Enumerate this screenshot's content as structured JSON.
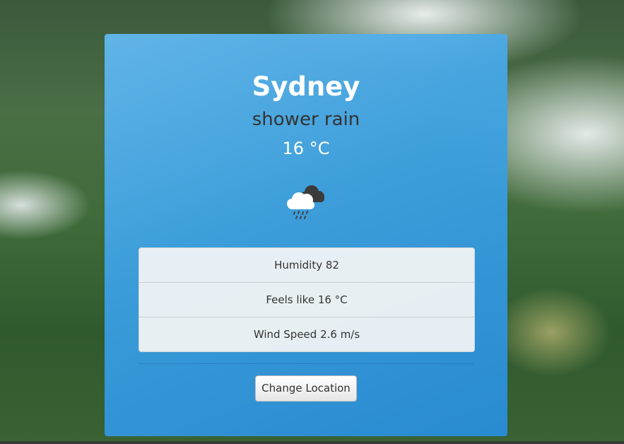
{
  "weather": {
    "city": "Sydney",
    "description": "shower rain",
    "temperature": "16 °C",
    "icon": "shower-rain-cloud-icon"
  },
  "details": [
    {
      "label": "Humidity 82"
    },
    {
      "label": "Feels like 16 °C"
    },
    {
      "label": "Wind Speed 2.6 m/s"
    }
  ],
  "actions": {
    "change_location_label": "Change Location"
  },
  "colors": {
    "card_accent": "#3fa0e2",
    "title_text": "#ffffff",
    "description_text": "#333333"
  }
}
